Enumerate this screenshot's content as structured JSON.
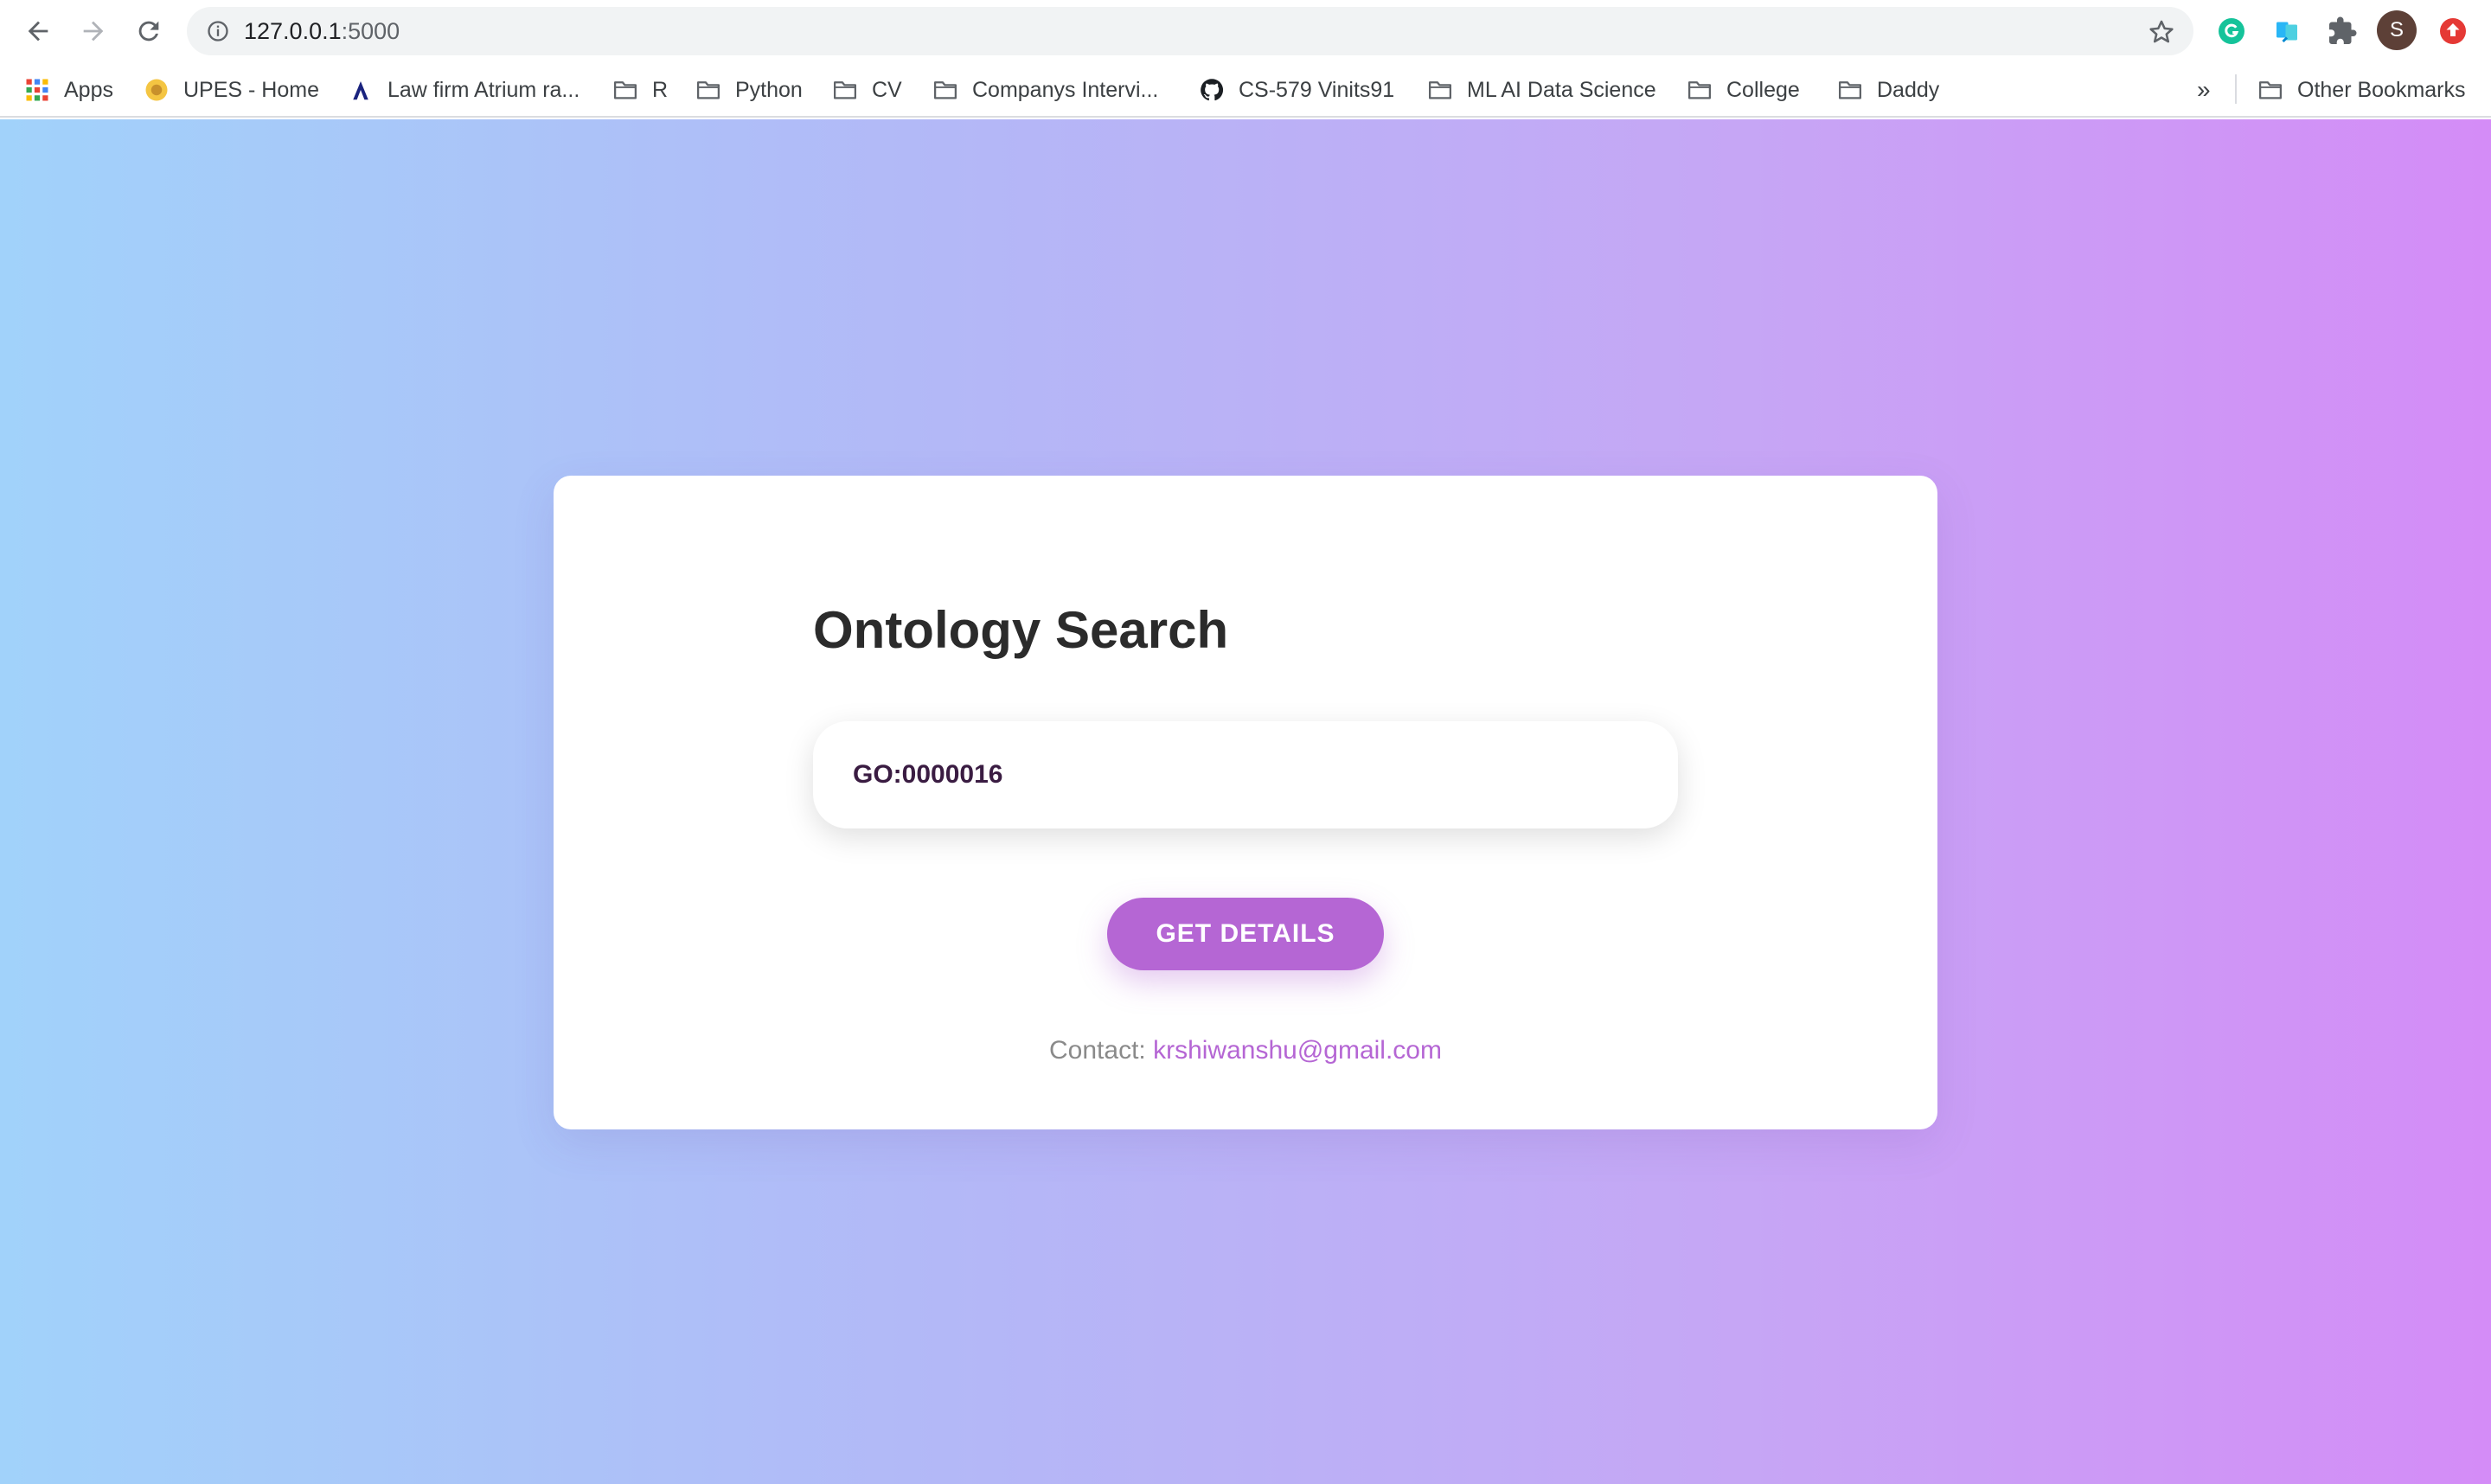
{
  "browser": {
    "url_host": "127.0.0.1",
    "url_port": ":5000",
    "avatar_initial": "S",
    "bookmarks": [
      {
        "label": "Apps",
        "icon": "apps-grid-icon"
      },
      {
        "label": "UPES - Home",
        "icon": "upes-favicon-icon"
      },
      {
        "label": "Law firm Atrium ra...",
        "icon": "atrium-favicon-icon"
      },
      {
        "label": "R",
        "icon": "folder-icon"
      },
      {
        "label": "Python",
        "icon": "folder-icon"
      },
      {
        "label": "CV",
        "icon": "folder-icon"
      },
      {
        "label": "Companys Intervi...",
        "icon": "folder-icon"
      },
      {
        "label": "CS-579 Vinits91",
        "icon": "github-icon"
      },
      {
        "label": "ML AI Data Science",
        "icon": "folder-icon"
      },
      {
        "label": "College",
        "icon": "folder-icon"
      },
      {
        "label": "Daddy",
        "icon": "folder-icon"
      }
    ],
    "more_bookmarks": "»",
    "other_bookmarks": "Other Bookmarks"
  },
  "page": {
    "title": "Ontology Search",
    "search_value": "GO:0000016",
    "button_label": "GET DETAILS",
    "contact_label": "Contact: ",
    "contact_email": "krshiwanshu@gmail.com"
  },
  "colors": {
    "accent": "#b566d4",
    "gradient_start": "#a1d2fa",
    "gradient_end": "#d48cf7"
  }
}
